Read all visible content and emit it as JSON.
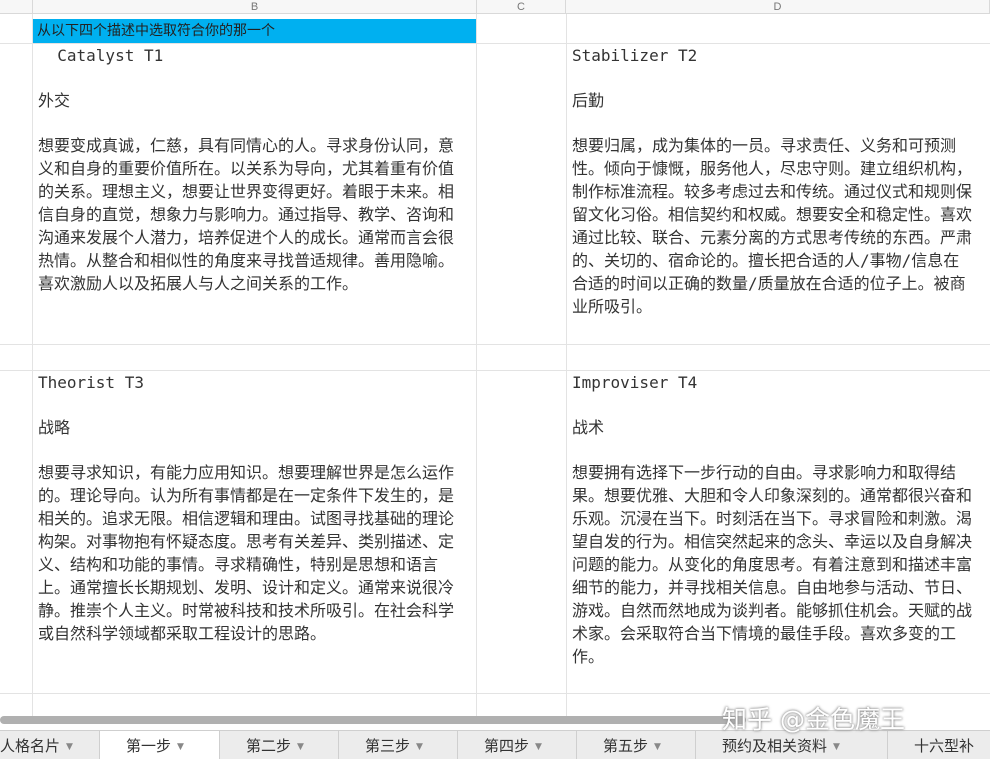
{
  "columns": {
    "b": "B",
    "c": "C",
    "d": "D"
  },
  "banner": "从以下四个描述中选取符合你的那一个",
  "cells": {
    "t1": {
      "title": "  Catalyst T1",
      "sub": "外交",
      "desc": "想要变成真诚，仁慈，具有同情心的人。寻求身份认同，意义和自身的重要价值所在。以关系为导向，尤其着重有价值的关系。理想主义，想要让世界变得更好。着眼于未来。相信自身的直觉，想象力与影响力。通过指导、教学、咨询和沟通来发展个人潜力，培养促进个人的成长。通常而言会很热情。从整合和相似性的角度来寻找普适规律。善用隐喻。喜欢激励人以及拓展人与人之间关系的工作。"
    },
    "t2": {
      "title": "Stabilizer T2",
      "sub": "后勤",
      "desc": "想要归属，成为集体的一员。寻求责任、义务和可预测性。倾向于慷慨，服务他人，尽忠守则。建立组织机构，制作标准流程。较多考虑过去和传统。通过仪式和规则保留文化习俗。相信契约和权威。想要安全和稳定性。喜欢通过比较、联合、元素分离的方式思考传统的东西。严肃的、关切的、宿命论的。擅长把合适的人/事物/信息在合适的时间以正确的数量/质量放在合适的位子上。被商业所吸引。"
    },
    "t3": {
      "title": "Theorist T3",
      "sub": "战略",
      "desc": "想要寻求知识，有能力应用知识。想要理解世界是怎么运作的。理论导向。认为所有事情都是在一定条件下发生的，是相关的。追求无限。相信逻辑和理由。试图寻找基础的理论构架。对事物抱有怀疑态度。思考有关差异、类别描述、定义、结构和功能的事情。寻求精确性，特别是思想和语言上。通常擅长长期规划、发明、设计和定义。通常来说很冷静。推崇个人主义。时常被科技和技术所吸引。在社会科学或自然科学领域都采取工程设计的思路。"
    },
    "t4": {
      "title": "Improviser T4",
      "sub": "战术",
      "desc": "想要拥有选择下一步行动的自由。寻求影响力和取得结果。想要优雅、大胆和令人印象深刻的。通常都很兴奋和乐观。沉浸在当下。时刻活在当下。寻求冒险和刺激。渴望自发的行为。相信突然起来的念头、幸运以及自身解决问题的能力。从变化的角度思考。有着注意到和描述丰富细节的能力，并寻找相关信息。自由地参与活动、节日、游戏。自然而然地成为谈判者。能够抓住机会。天赋的战术家。会采取符合当下情境的最佳手段。喜欢多变的工作。"
    }
  },
  "tabs": [
    {
      "label": "人格名片"
    },
    {
      "label": "第一步"
    },
    {
      "label": "第二步"
    },
    {
      "label": "第三步"
    },
    {
      "label": "第四步"
    },
    {
      "label": "第五步"
    },
    {
      "label": "预约及相关资料"
    },
    {
      "label": "十六型补"
    }
  ],
  "tab_caret": "▼",
  "watermark": "知乎 @金色魔王",
  "colors": {
    "banner": "#00b0f0",
    "grid": "#e3e3e3",
    "tabbar": "#ececec"
  }
}
